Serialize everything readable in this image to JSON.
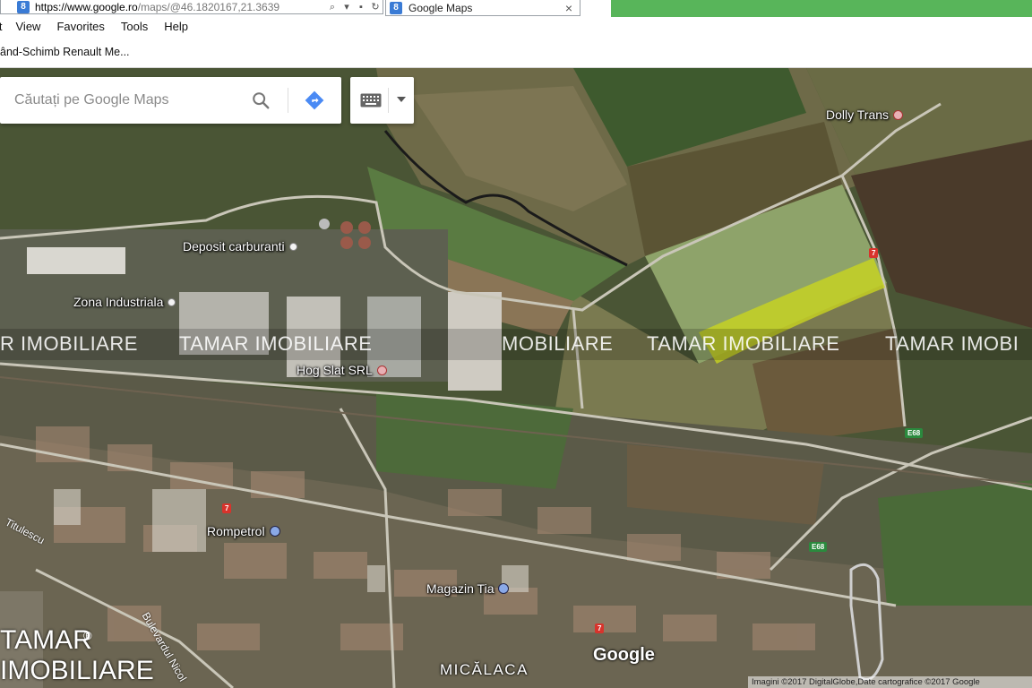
{
  "browser": {
    "url_host": "https://www.google.ro",
    "url_path": "/maps/@46.1820167,21.3639",
    "tab_title": "Google Maps",
    "tab_close": "×",
    "menu": [
      "it",
      "View",
      "Favorites",
      "Tools",
      "Help"
    ],
    "favorite": "ând-Schimb Renault Me..."
  },
  "search": {
    "placeholder": "Căutați pe Google Maps"
  },
  "map": {
    "pois": {
      "dolly_trans": "Dolly Trans",
      "deposit": "Deposit carburanti",
      "zona": "Zona Industriala",
      "hog": "Hog Slat SRL",
      "rompetrol": "Rompetrol",
      "magazin": "Magazin Tia"
    },
    "neighborhood": "MICĂLACA",
    "streets": {
      "titulescu": "Titulescu",
      "bulevardul": "Bulevardul Nicol"
    },
    "road_shields": {
      "r7": "7",
      "e68a": "E68",
      "e68b": "E68",
      "r7b": "7",
      "r7c": "7",
      "r7d": "7"
    },
    "google_logo": "Google",
    "attribution": "Imagini ©2017 DigitalGlobe,Date cartografice ©2017 Google",
    "highlight_color": "#c9d41f"
  },
  "watermark": {
    "text_1": "R IMOBILIARE",
    "text_2": "TAMAR IMOBILIARE",
    "text_3": "MOBILIARE",
    "text_4": "TAMAR IMOBILIARE",
    "text_5": "TAMAR IMOBI",
    "brand_name": "TAMAR",
    "brand_reg": "®",
    "brand_sub": "IMOBILIARE"
  }
}
